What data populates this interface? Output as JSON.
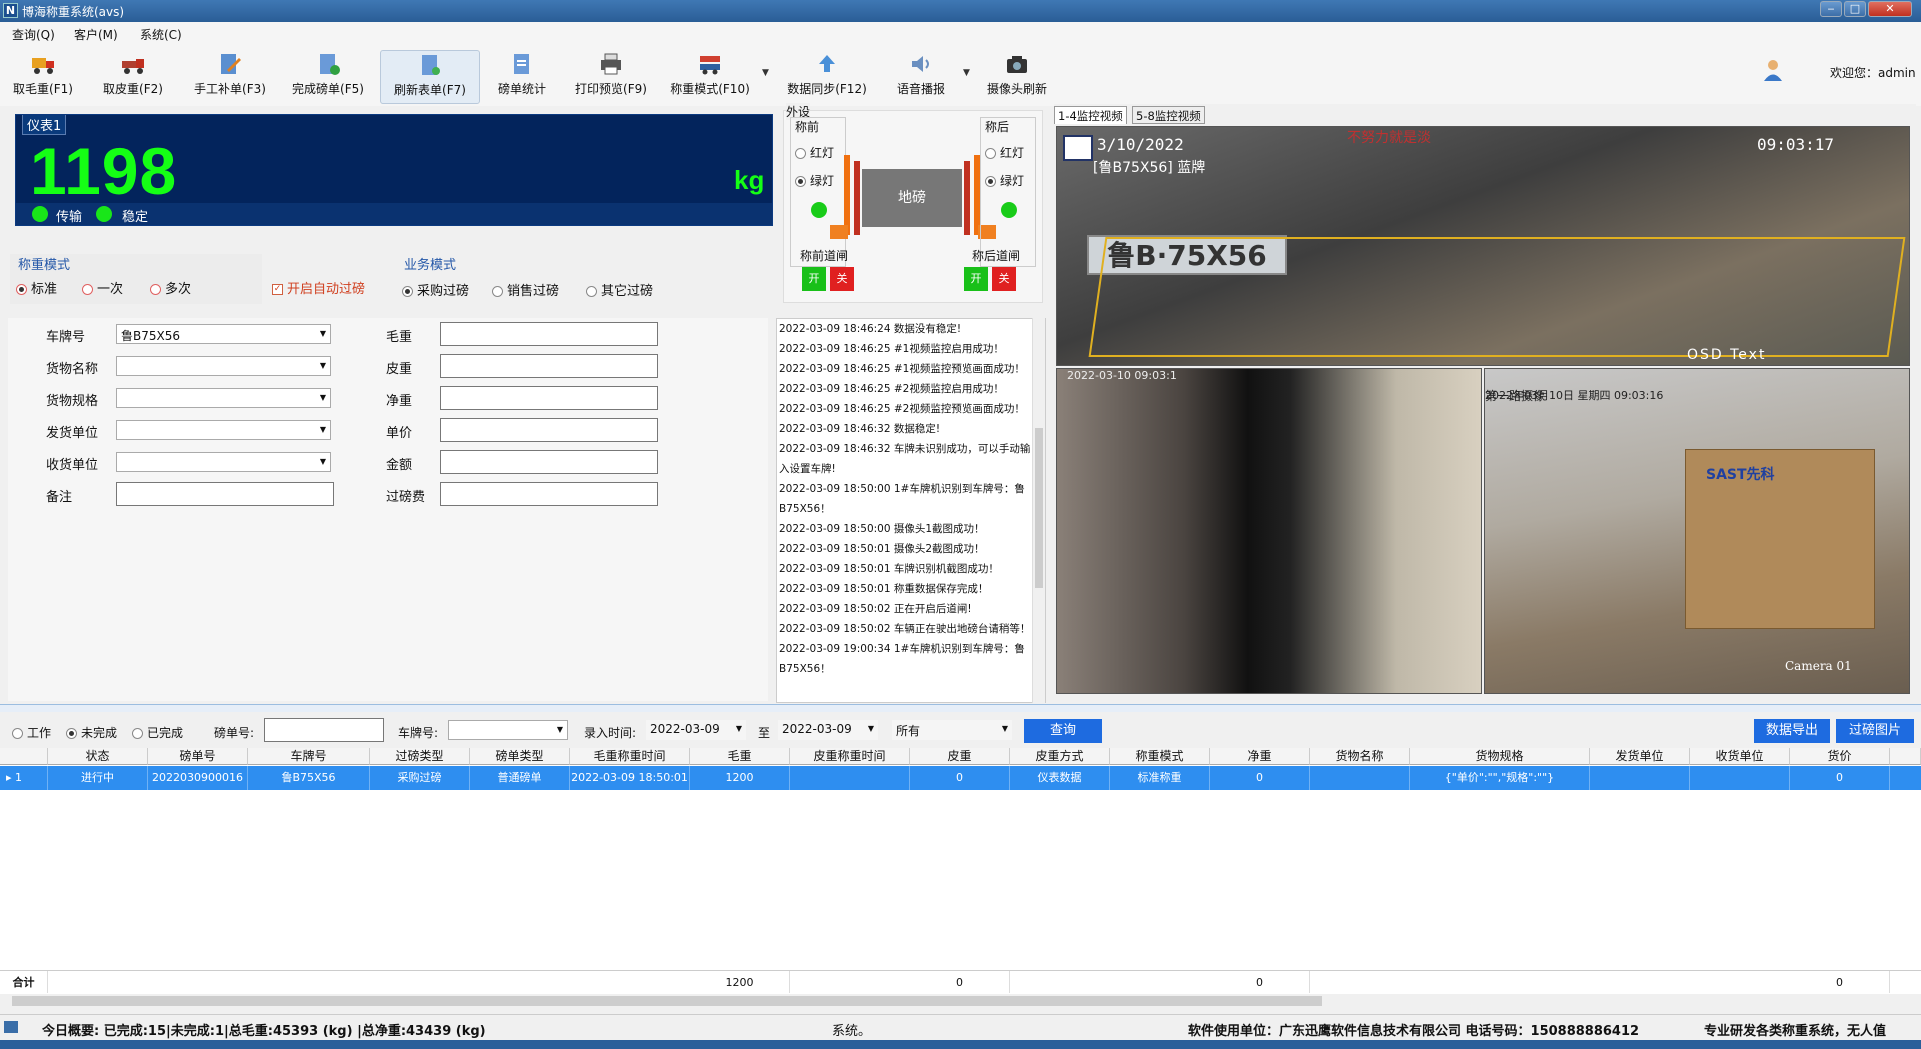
{
  "window": {
    "title": "博海称重系统(avs)",
    "app_icon": "N",
    "minimize": "‒",
    "maximize": "□",
    "close": "✕"
  },
  "menu": [
    {
      "label": "查询(Q)"
    },
    {
      "label": "客户(M)"
    },
    {
      "label": "系统(C)"
    }
  ],
  "toolbar": [
    {
      "label": "取毛重(F1)",
      "icon": "truck-red-icon"
    },
    {
      "label": "取皮重(F2)",
      "icon": "truck-icon"
    },
    {
      "label": "手工补单(F3)",
      "icon": "edit-document-icon"
    },
    {
      "label": "完成磅单(F5)",
      "icon": "document-check-icon"
    },
    {
      "label": "刷新表单(F7)",
      "icon": "document-refresh-icon"
    },
    {
      "label": "磅单统计",
      "icon": "document-stats-icon"
    },
    {
      "label": "打印预览(F9)",
      "icon": "printer-icon"
    },
    {
      "label": "称重模式(F10)",
      "icon": "scale-mode-icon"
    },
    {
      "label": "数据同步(F12)",
      "icon": "upload-icon"
    },
    {
      "label": "语音播报",
      "icon": "speaker-icon"
    },
    {
      "label": "摄像头刷新",
      "icon": "camera-icon"
    }
  ],
  "user": {
    "welcome": "欢迎您：admin"
  },
  "meter": {
    "label": "仪表1",
    "value": "1198",
    "unit": "kg",
    "status1": "传输",
    "status2": "稳定"
  },
  "weigh_mode": {
    "title": "称重模式",
    "options": [
      "标准",
      "一次",
      "多次"
    ],
    "selected": "标准",
    "auto_label": "开启自动过磅",
    "auto_checked": true
  },
  "business_mode": {
    "title": "业务模式",
    "options": [
      "采购过磅",
      "销售过磅",
      "其它过磅"
    ],
    "selected": "采购过磅"
  },
  "devices": {
    "title": "外设",
    "front": {
      "title": "称前",
      "red": "红灯",
      "green": "绿灯",
      "gate": "称前道闸",
      "open": "开",
      "close": "关"
    },
    "back": {
      "title": "称后",
      "red": "红灯",
      "green": "绿灯",
      "gate": "称后道闸",
      "open": "开",
      "close": "关"
    },
    "scale": "地磅"
  },
  "form": {
    "left": [
      {
        "label": "车牌号",
        "value": "鲁B75X56"
      },
      {
        "label": "货物名称",
        "value": ""
      },
      {
        "label": "货物规格",
        "value": ""
      },
      {
        "label": "发货单位",
        "value": ""
      },
      {
        "label": "收货单位",
        "value": ""
      },
      {
        "label": "备注",
        "value": ""
      }
    ],
    "right": [
      {
        "label": "毛重"
      },
      {
        "label": "皮重"
      },
      {
        "label": "净重"
      },
      {
        "label": "单价"
      },
      {
        "label": "金额"
      },
      {
        "label": "过磅费"
      }
    ]
  },
  "log": [
    "2022-03-09 18:46:24 数据没有稳定!",
    "2022-03-09 18:46:25 #1视频监控启用成功！",
    "2022-03-09 18:46:25 #1视频监控预览画面成功！",
    "2022-03-09 18:46:25 #2视频监控启用成功！",
    "2022-03-09 18:46:25 #2视频监控预览画面成功！",
    "2022-03-09 18:46:32 数据稳定!",
    "2022-03-09 18:46:32 车牌未识别成功，可以手动输",
    "入设置车牌!",
    "2022-03-09 18:50:00 1#车牌机识别到车牌号：鲁",
    "B75X56！",
    "2022-03-09 18:50:00 摄像头1截图成功！",
    "2022-03-09 18:50:01 摄像头2截图成功！",
    "2022-03-09 18:50:01 车牌识别机截图成功！",
    "2022-03-09 18:50:01 称重数据保存完成！",
    "2022-03-09 18:50:02 正在开启后道闸!",
    "2022-03-09 18:50:02 车辆正在驶出地磅台请稍等！",
    "2022-03-09 19:00:34 1#车牌机识别到车牌号：鲁",
    "B75X56！"
  ],
  "video": {
    "tabs": [
      "1-4监控视频",
      "5-8监控视频"
    ],
    "cam1": {
      "date": "3/10/2022",
      "time": "09:03:17",
      "plate_overlay": "[鲁B75X56] 蓝牌",
      "plate": "鲁B·75X56",
      "osd": "OSD Text",
      "top_text": "不努力就是淡"
    },
    "cam2": {
      "date": "2022-03-10 09:03:1"
    },
    "cam3": {
      "label": "第一路摄像",
      "date": "2022年03月10日 星期四 09:03:16",
      "footer": "Camera 01",
      "box_brand": "SAST先科"
    }
  },
  "filter": {
    "work": "工作",
    "incomplete": "未完成",
    "complete": "已完成",
    "selected": "未完成",
    "ticket_label": "磅单号:",
    "ticket_value": "",
    "plate_label": "车牌号:",
    "plate_value": "",
    "time_label": "录入时间:",
    "date_from": "2022-03-09",
    "to": "至",
    "date_to": "2022-03-09",
    "type_value": "所有",
    "query": "查询",
    "export": "数据导出",
    "photo": "过磅图片"
  },
  "grid": {
    "headers": [
      "状态",
      "磅单号",
      "车牌号",
      "过磅类型",
      "磅单类型",
      "毛重称重时间",
      "毛重",
      "皮重称重时间",
      "皮重",
      "皮重方式",
      "称重模式",
      "净重",
      "货物名称",
      "货物规格",
      "发货单位",
      "收货单位",
      "货价"
    ],
    "rows": [
      {
        "index": "1",
        "cells": [
          "进行中",
          "2022030900016",
          "鲁B75X56",
          "采购过磅",
          "普通磅单",
          "2022-03-09 18:50:01",
          "1200",
          "",
          "0",
          "仪表数据",
          "标准称重",
          "0",
          "",
          "{\"单价\":\"\",\"规格\":\"\"}",
          "",
          "",
          "0"
        ]
      }
    ],
    "sum_label": "合计",
    "sums": [
      "",
      "",
      "",
      "",
      "",
      "1200",
      "",
      "0",
      "",
      "",
      "0",
      "",
      "",
      "",
      "",
      "0"
    ]
  },
  "status": {
    "summary": "今日概要:  已完成:15|未完成:1|总毛重:45393 (kg)  |总净重:43439 (kg)",
    "system": "系统。",
    "company": "软件使用单位：广东迅鹰软件信息技术有限公司  电话号码：150888886412",
    "slogan": "专业研发各类称重系统，无人值"
  },
  "colors": {
    "accent": "#1e6be0",
    "meter_bg": "#03245c",
    "meter_digits": "#15ff15",
    "row_selected": "#2e8ef0"
  }
}
